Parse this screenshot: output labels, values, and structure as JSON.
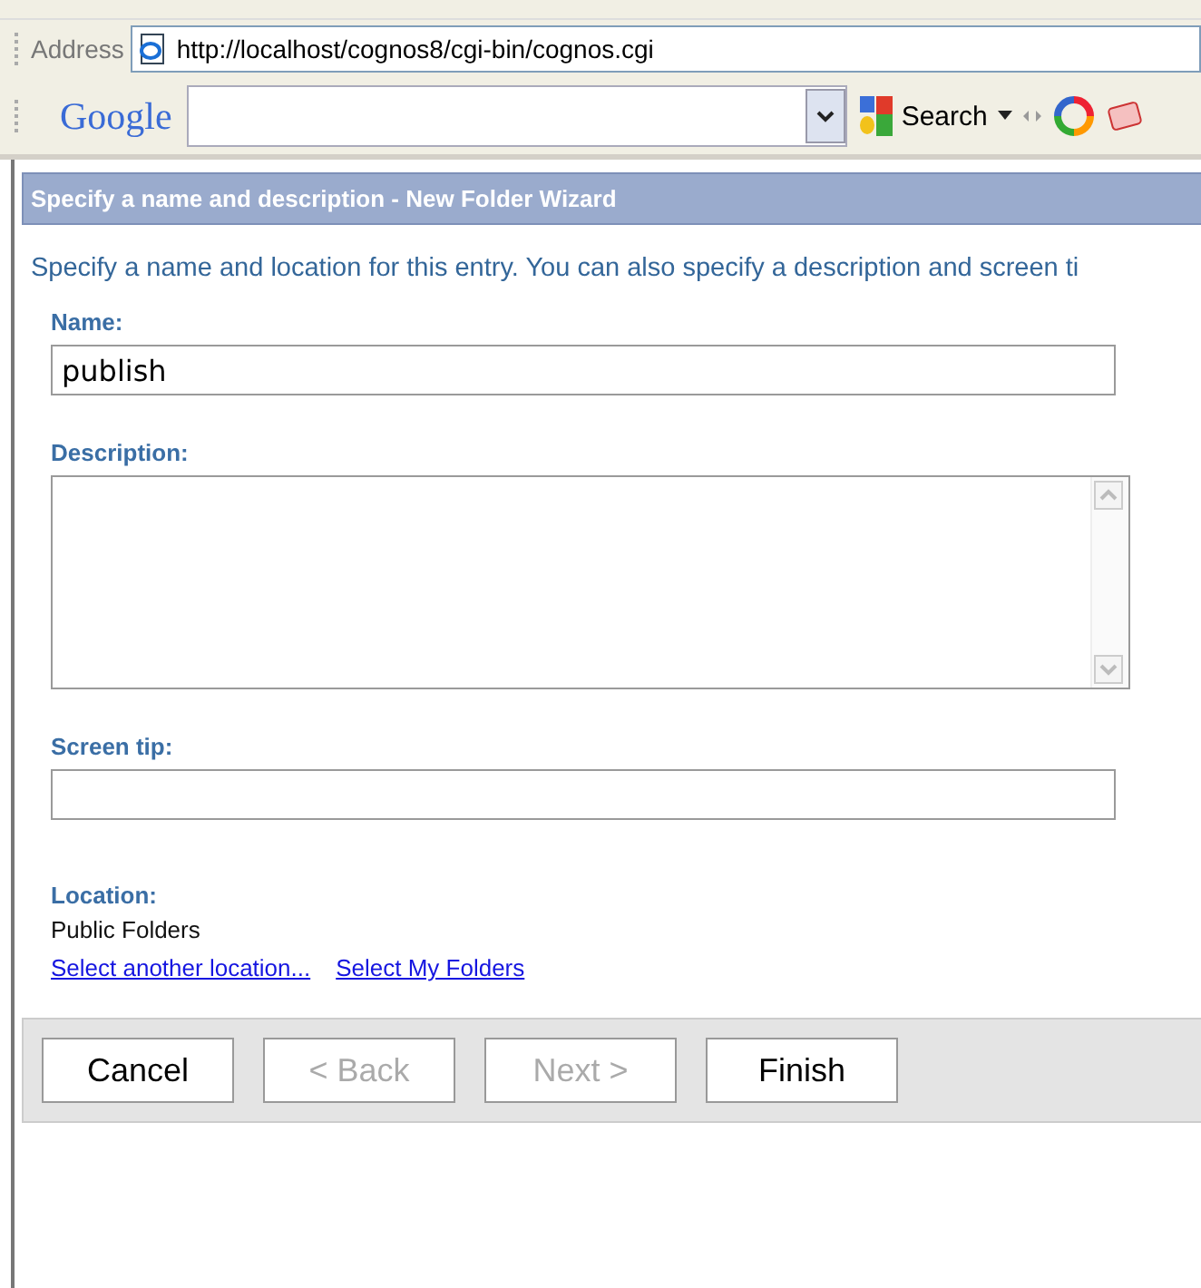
{
  "address_bar": {
    "label": "Address",
    "url": "http://localhost/cognos8/cgi-bin/cognos.cgi"
  },
  "google_toolbar": {
    "logo": "Google",
    "search_button": "Search"
  },
  "wizard": {
    "title": "Specify a name and description - New Folder Wizard",
    "intro": "Specify a name and location for this entry. You can also specify a description and screen ti",
    "fields": [
      {
        "label": "Name:",
        "kind": "input",
        "value": "publish"
      },
      {
        "label": "Description:",
        "kind": "textarea"
      },
      {
        "label": "Screen tip:",
        "kind": "input"
      }
    ],
    "location": {
      "label": "Location:",
      "value": "Public Folders",
      "links": [
        "Select another location...",
        "Select My Folders"
      ]
    },
    "buttons": [
      {
        "label": "Cancel",
        "disabled": false
      },
      {
        "label": "< Back",
        "disabled": true
      },
      {
        "label": "Next >",
        "disabled": true
      },
      {
        "label": "Finish",
        "disabled": false
      }
    ]
  }
}
